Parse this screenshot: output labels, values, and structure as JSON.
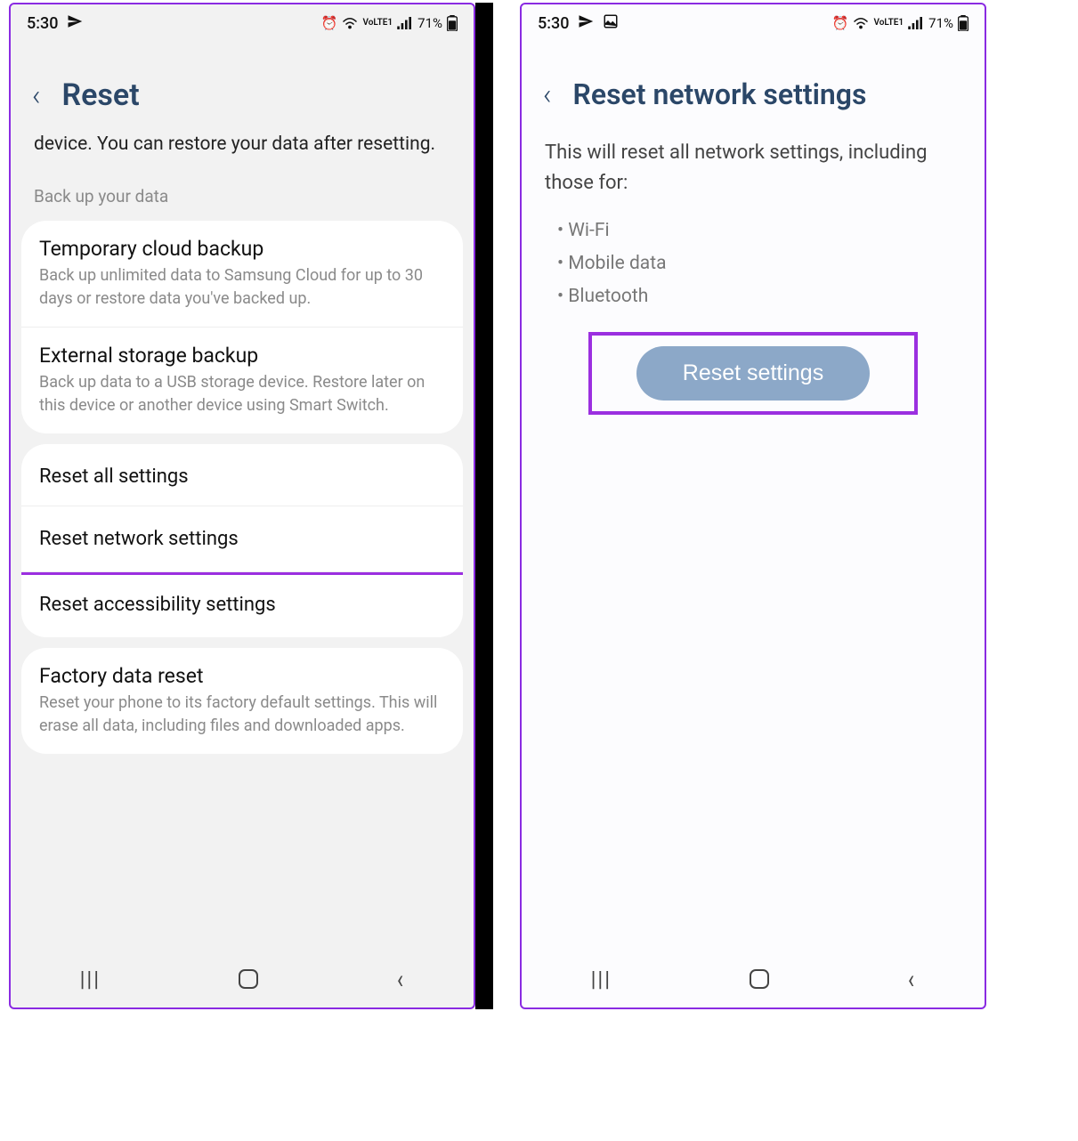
{
  "status": {
    "time": "5:30",
    "battery_pct": "71%",
    "lte": "VoLTE1"
  },
  "left": {
    "title": "Reset",
    "intro": "device. You can restore your data after resetting.",
    "backup_label": "Back up your data",
    "cloud_title": "Temporary cloud backup",
    "cloud_sub": "Back up unlimited data to Samsung Cloud for up to 30 days or restore data you've backed up.",
    "ext_title": "External storage backup",
    "ext_sub": "Back up data to a USB storage device. Restore later on this device or another device using Smart Switch.",
    "reset_all": "Reset all settings",
    "reset_net": "Reset network settings",
    "reset_acc": "Reset accessibility settings",
    "factory_title": "Factory data reset",
    "factory_sub": "Reset your phone to its factory default settings. This will erase all data, including files and downloaded apps."
  },
  "right": {
    "title": "Reset network settings",
    "intro": "This will reset all network settings, including those for:",
    "bullets": {
      "b1": "Wi-Fi",
      "b2": "Mobile data",
      "b3": "Bluetooth"
    },
    "button": "Reset settings"
  }
}
